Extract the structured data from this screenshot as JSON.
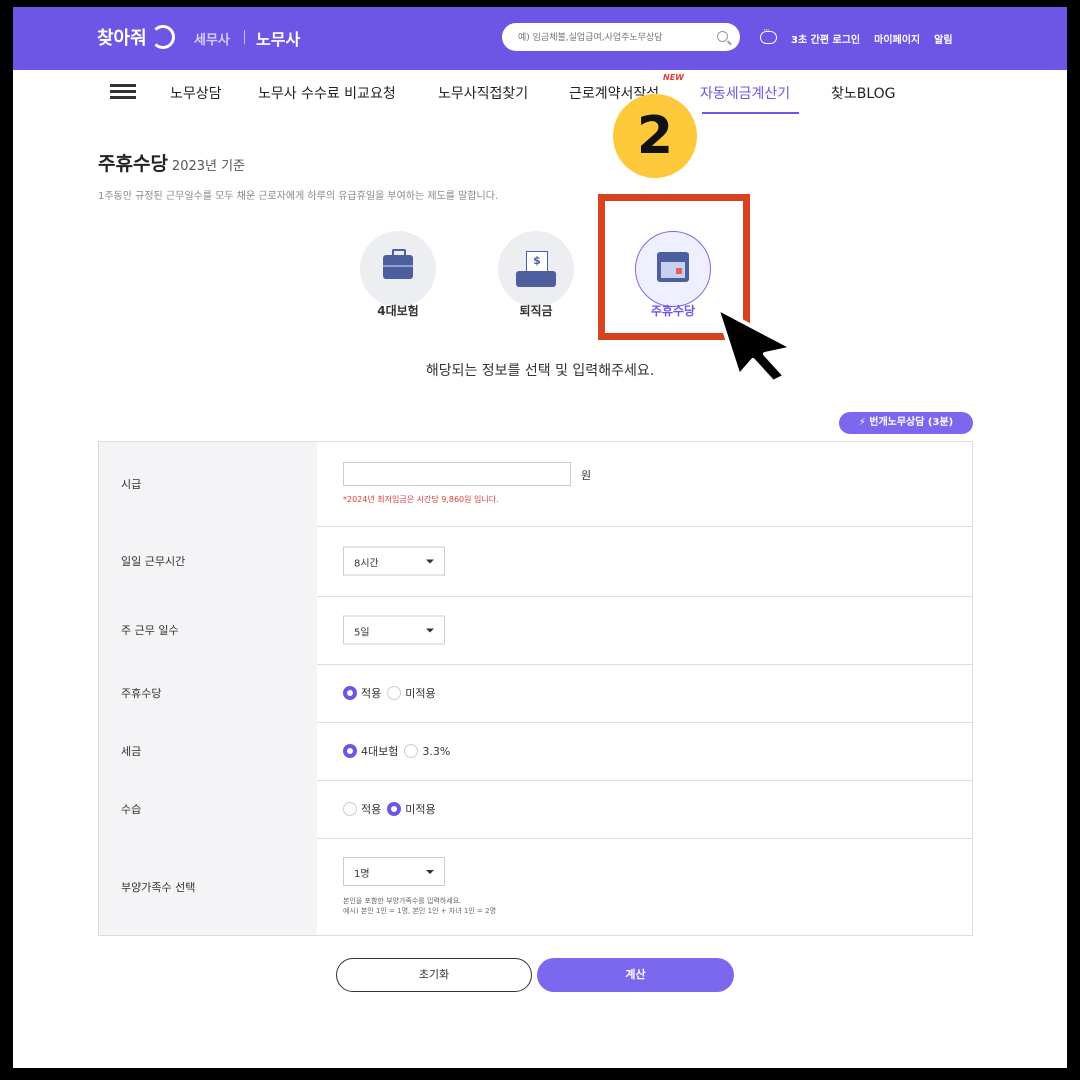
{
  "header": {
    "logo": "찾아줘",
    "brand_tax": "세무사",
    "brand_labor": "노무사",
    "search_placeholder": "예) 임금체불,실업급여,사업주노무상담",
    "links": [
      "3초 간편 로그인",
      "마이페이지",
      "알림"
    ],
    "bg_color": "#6d55e6"
  },
  "nav": {
    "items": [
      "노무상담",
      "노무사 수수료 비교요청",
      "노무사직접찾기",
      "근로계약서작성",
      "자동세금계산기",
      "찾노BLOG"
    ],
    "active": "자동세금계산기",
    "new_badge": "NEW"
  },
  "step_badge": "2",
  "page": {
    "title": "주휴수당",
    "title_sub": "2023년 기준",
    "description": "1주동안 규정된 근무일수를 모두 채운 근로자에게 하루의 유급휴일을 부여하는 제도를 말합니다."
  },
  "categories": [
    {
      "label": "4대보험",
      "icon": "briefcase-icon"
    },
    {
      "label": "퇴직금",
      "icon": "money-tray-icon"
    },
    {
      "label": "주휴수당",
      "icon": "calendar-icon",
      "selected": true
    }
  ],
  "instruction": "해당되는 정보를 선택 및 입력해주세요.",
  "quick_consult": "⚡ 번개노무상담 (3분)",
  "form": {
    "wage": {
      "label": "시급",
      "value": "",
      "unit": "원",
      "note": "*2024년 최저임금은 시간당 9,860원 입니다."
    },
    "daily_hours": {
      "label": "일일 근무시간",
      "selected": "8시간"
    },
    "weekly_days": {
      "label": "주 근무 일수",
      "selected": "5일"
    },
    "holiday_pay": {
      "label": "주휴수당",
      "options": [
        "적용",
        "미적용"
      ],
      "selected": "적용"
    },
    "tax": {
      "label": "세금",
      "options": [
        "4대보험",
        "3.3%"
      ],
      "selected": "4대보험"
    },
    "probation": {
      "label": "수습",
      "options": [
        "적용",
        "미적용"
      ],
      "selected": "미적용"
    },
    "dependents": {
      "label": "부양가족수 선택",
      "selected": "1명",
      "note_1": "본인을 포함한 부양가족수를 입력하세요.",
      "note_2": "예시) 본인 1인 = 1명, 본인 1인 + 자녀 1인 = 2명"
    }
  },
  "buttons": {
    "reset": "초기화",
    "calculate": "계산"
  },
  "colors": {
    "accent": "#6d55e6",
    "highlight": "#d6431d",
    "badge": "#fdc93a",
    "note_red": "#e03a3a"
  }
}
